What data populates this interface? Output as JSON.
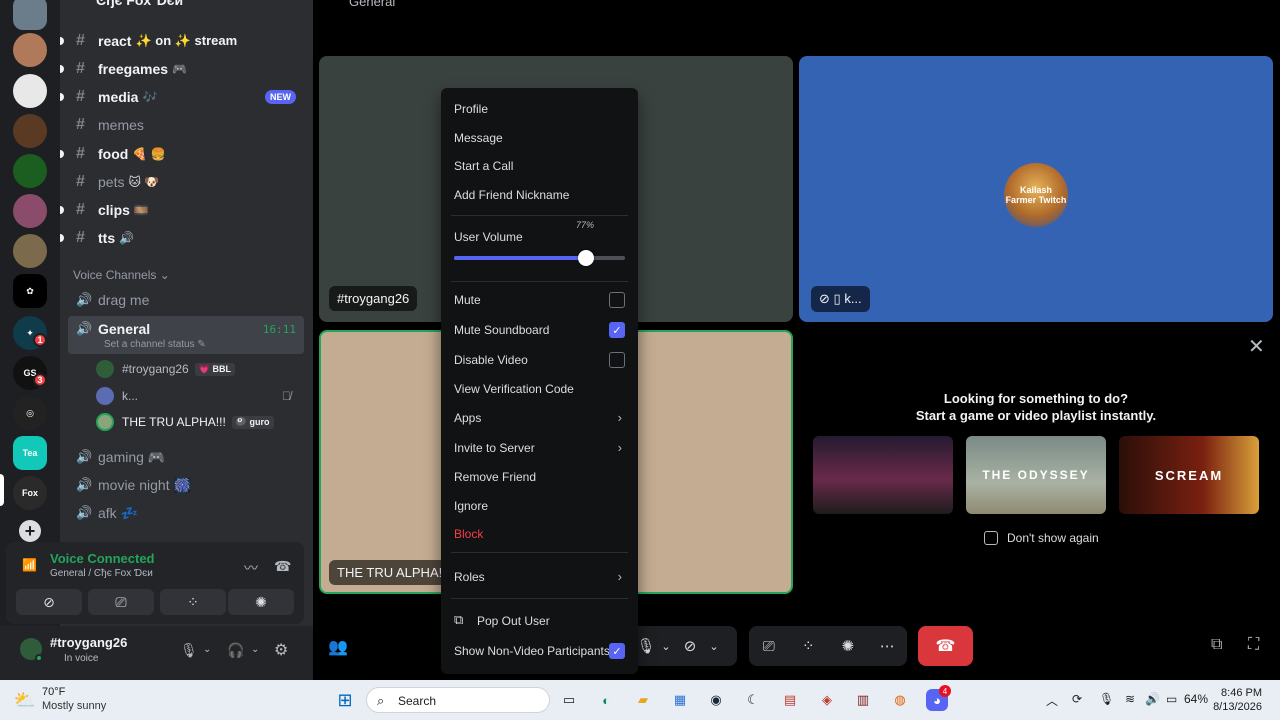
{
  "server": {
    "name": "Ͼђє Fox Ɗєи"
  },
  "rail": {
    "badges": [
      "1",
      "3"
    ],
    "add_label": "+"
  },
  "channels": [
    {
      "name": "react",
      "emoji": "✨ on ✨ stream",
      "state": "unread"
    },
    {
      "name": "freegames",
      "emoji": "🎮",
      "state": "unread"
    },
    {
      "name": "media",
      "emoji": "🎶",
      "state": "unread",
      "badge": "NEW"
    },
    {
      "name": "memes",
      "emoji": "",
      "state": "read"
    },
    {
      "name": "food",
      "emoji": "🍕 🍔",
      "state": "unread"
    },
    {
      "name": "pets",
      "emoji": "🐱 🐶",
      "state": "read"
    },
    {
      "name": "clips",
      "emoji": "🎞️",
      "state": "unread"
    },
    {
      "name": "tts",
      "emoji": "🔊",
      "state": "unread"
    }
  ],
  "voice_category": "Voice Channels",
  "voice_channels": {
    "drag_me": "drag me",
    "general": {
      "name": "General",
      "status": "Set a channel status",
      "timer": "16:11"
    },
    "users": [
      {
        "name": "#troygang26",
        "tag": "💗 BBL"
      },
      {
        "name": "k..."
      },
      {
        "name": "THE TRU ALPHA!!!",
        "tag": "🎱 guro"
      }
    ],
    "gaming": "gaming 🎮",
    "movie_night": "movie night 🎆",
    "afk": "afk 💤"
  },
  "voice_connected": {
    "title": "Voice Connected",
    "subtitle": "General / Ͼђє Fox Ɗєи"
  },
  "user": {
    "name": "#troygang26",
    "status": "In voice"
  },
  "stage": {
    "header": "General",
    "tiles": {
      "troy": "#troygang26",
      "k": "k...",
      "alpha": "THE TRU ALPHA!!!"
    },
    "kailash": "Kailash\nFarmer Twitch",
    "promo": {
      "line1": "Looking for something to do?",
      "line2": "Start a game or video playlist instantly.",
      "games": [
        "",
        "THE ODYSSEY",
        "SCREAM"
      ],
      "dont_show": "Don't show again"
    }
  },
  "menu": {
    "items_top": [
      "Profile",
      "Message",
      "Start a Call",
      "Add Friend Nickname"
    ],
    "volume_label": "User Volume",
    "volume_value": 0.77,
    "volume_text": "77%",
    "toggles": [
      {
        "label": "Mute",
        "checked": false
      },
      {
        "label": "Mute Soundboard",
        "checked": true
      },
      {
        "label": "Disable Video",
        "checked": false
      }
    ],
    "items_mid": [
      "View Verification Code",
      "Apps",
      "Invite to Server",
      "Remove Friend",
      "Ignore",
      "Block"
    ],
    "roles": "Roles",
    "popout": "Pop Out User",
    "show_non_video": "Show Non-Video Participants"
  },
  "taskbar": {
    "weather_temp": "70°F",
    "weather_desc": "Mostly sunny",
    "search": "Search",
    "battery": "64%",
    "time": "8:46 PM",
    "date": "8/13/2026",
    "discord_badge": "4"
  },
  "colors": {
    "accent": "#5865f2",
    "green": "#23a55a",
    "danger": "#da373c"
  }
}
